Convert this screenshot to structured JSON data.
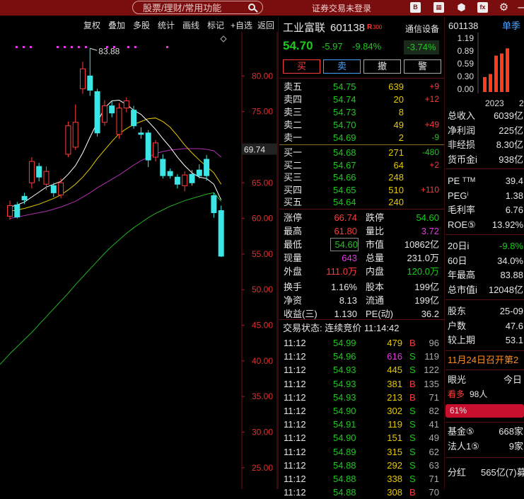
{
  "top": {
    "search_placeholder": "股票/理财/常用功能",
    "login_status": "证券交易未登录"
  },
  "toolbar": [
    "复权",
    "叠加",
    "多股",
    "统计",
    "画线",
    "标记",
    "+自选",
    "返回"
  ],
  "chart_data": {
    "type": "candlestick",
    "ylim": [
      22,
      85
    ],
    "y_ticks": [
      "80.00",
      "75.00",
      "70.00",
      "65.00",
      "60.00",
      "55.00",
      "50.00",
      "45.00",
      "40.00",
      "35.00",
      "30.00",
      "25.00"
    ],
    "y_tick_values": [
      80,
      75,
      70,
      65,
      60,
      55,
      50,
      45,
      40,
      35,
      30,
      25
    ],
    "current_price_label": "69.74",
    "current_price_value": 69.74,
    "high_annotation": "83.88",
    "candles": [
      {
        "o": 60.3,
        "c": 61.8,
        "h": 62.5,
        "l": 59.8
      },
      {
        "o": 61.9,
        "c": 60.2,
        "h": 62.3,
        "l": 60.0
      },
      {
        "o": 63.1,
        "c": 62.6,
        "h": 63.6,
        "l": 62.0
      },
      {
        "o": 65.0,
        "c": 68.0,
        "h": 68.6,
        "l": 64.2
      },
      {
        "o": 67.3,
        "c": 65.8,
        "h": 67.8,
        "l": 65.2
      },
      {
        "o": 64.8,
        "c": 66.6,
        "h": 67.3,
        "l": 64.0
      },
      {
        "o": 64.6,
        "c": 63.6,
        "h": 65.0,
        "l": 63.0
      },
      {
        "o": 63.3,
        "c": 65.0,
        "h": 65.6,
        "l": 62.8
      },
      {
        "o": 69.0,
        "c": 73.0,
        "h": 73.6,
        "l": 68.6
      },
      {
        "o": 70.0,
        "c": 73.5,
        "h": 76.0,
        "l": 69.6
      },
      {
        "o": 78.2,
        "c": 81.0,
        "h": 82.0,
        "l": 77.5
      },
      {
        "o": 80.0,
        "c": 78.0,
        "h": 83.88,
        "l": 77.2
      },
      {
        "o": 77.8,
        "c": 72.0,
        "h": 78.2,
        "l": 71.5
      },
      {
        "o": 73.5,
        "c": 75.8,
        "h": 76.6,
        "l": 73.0
      },
      {
        "o": 75.8,
        "c": 74.8,
        "h": 76.4,
        "l": 74.2
      },
      {
        "o": 71.8,
        "c": 75.5,
        "h": 76.2,
        "l": 71.2
      },
      {
        "o": 75.5,
        "c": 76.5,
        "h": 77.0,
        "l": 74.9
      },
      {
        "o": 75.2,
        "c": 73.0,
        "h": 75.8,
        "l": 72.6
      },
      {
        "o": 72.0,
        "c": 71.8,
        "h": 72.8,
        "l": 71.2
      },
      {
        "o": 72.0,
        "c": 68.2,
        "h": 72.4,
        "l": 67.2
      },
      {
        "o": 68.6,
        "c": 70.6,
        "h": 71.0,
        "l": 68.0
      },
      {
        "o": 68.3,
        "c": 66.0,
        "h": 69.0,
        "l": 65.6
      },
      {
        "o": 66.6,
        "c": 66.0,
        "h": 67.0,
        "l": 65.6
      },
      {
        "o": 65.8,
        "c": 64.8,
        "h": 66.2,
        "l": 64.2
      },
      {
        "o": 64.6,
        "c": 66.1,
        "h": 66.6,
        "l": 63.8
      },
      {
        "o": 66.2,
        "c": 65.0,
        "h": 66.8,
        "l": 64.6
      },
      {
        "o": 66.8,
        "c": 66.0,
        "h": 67.6,
        "l": 65.6
      },
      {
        "o": 68.3,
        "c": 66.0,
        "h": 68.9,
        "l": 65.3
      },
      {
        "o": 63.2,
        "c": 60.8,
        "h": 63.6,
        "l": 60.1
      },
      {
        "o": 61.1,
        "c": 54.7,
        "h": 61.8,
        "l": 54.6
      }
    ],
    "ma5": [
      61.6,
      61.9,
      62.3,
      63.0,
      63.7,
      64.4,
      64.8,
      65.2,
      66.2,
      67.4,
      69.2,
      71.4,
      73.5,
      75.5,
      76.5,
      76.6,
      76.0,
      75.2,
      74.6,
      73.6,
      72.5,
      71.2,
      70.0,
      68.6,
      67.4,
      66.4,
      65.8,
      65.6,
      64.8,
      62.6
    ],
    "ma10": [
      61.0,
      61.2,
      61.4,
      61.7,
      62.0,
      62.4,
      62.8,
      63.3,
      64.0,
      64.8,
      65.8,
      67.0,
      68.4,
      69.6,
      70.8,
      71.9,
      72.6,
      73.2,
      73.6,
      74.0,
      74.1,
      73.6,
      72.8,
      71.6,
      70.3,
      69.2,
      68.2,
      67.3,
      66.4,
      64.8
    ],
    "ma20": [
      60.0,
      60.2,
      60.4,
      60.6,
      60.8,
      61.0,
      61.3,
      61.6,
      62.0,
      62.4,
      63.0,
      63.6,
      64.3,
      64.9,
      65.5,
      66.1,
      66.8,
      67.5,
      68.1,
      68.6,
      69.1,
      69.4,
      69.6,
      69.7,
      69.8,
      69.8,
      69.8,
      69.7,
      69.5,
      68.6
    ],
    "ma60": [
      41.0,
      42.0,
      43.0,
      44.0,
      45.1,
      46.2,
      47.3,
      48.4,
      49.5,
      50.7,
      51.8,
      52.9,
      54.0,
      55.1,
      56.1,
      57.0,
      57.9,
      58.7,
      59.4,
      60.1,
      60.7,
      61.2,
      61.7,
      62.1,
      62.5,
      62.8,
      63.1,
      63.4,
      63.6,
      62.4
    ]
  },
  "quote": {
    "name": "工业富联",
    "code": "601138",
    "badge": "R",
    "badge_num": "300",
    "industry": "通信设备",
    "price": "54.70",
    "change": "-5.97",
    "pct": "-9.84%",
    "sector_pct": "-3.74%",
    "buttons": [
      "买",
      "卖",
      "撤",
      "警"
    ],
    "asks": [
      {
        "label": "卖五",
        "price": "54.75",
        "vol": "639",
        "chg": "+9"
      },
      {
        "label": "卖四",
        "price": "54.74",
        "vol": "20",
        "chg": "+12"
      },
      {
        "label": "卖三",
        "price": "54.73",
        "vol": "8",
        "chg": ""
      },
      {
        "label": "卖二",
        "price": "54.70",
        "vol": "49",
        "chg": "+49"
      },
      {
        "label": "卖一",
        "price": "54.69",
        "vol": "2",
        "chg": "-9"
      }
    ],
    "bids": [
      {
        "label": "买一",
        "price": "54.68",
        "vol": "271",
        "chg": "-480"
      },
      {
        "label": "买二",
        "price": "54.67",
        "vol": "64",
        "chg": "+2"
      },
      {
        "label": "买三",
        "price": "54.66",
        "vol": "248",
        "chg": ""
      },
      {
        "label": "买四",
        "price": "54.65",
        "vol": "510",
        "chg": "+110"
      },
      {
        "label": "买五",
        "price": "54.64",
        "vol": "240",
        "chg": ""
      }
    ],
    "stats": [
      [
        "涨停",
        "66.74",
        "跌停",
        "54.60"
      ],
      [
        "最高",
        "61.80",
        "量比",
        "3.72"
      ],
      [
        "最低",
        "54.60",
        "市值",
        "10862亿"
      ],
      [
        "现量",
        "643",
        "总量",
        "231.0万"
      ],
      [
        "外盘",
        "111.0万",
        "内盘",
        "120.0万"
      ],
      [
        "换手",
        "1.16%",
        "股本",
        "199亿"
      ],
      [
        "净资",
        "8.13",
        "流通",
        "199亿"
      ],
      [
        "收益(三)",
        "1.130",
        "PE(动)",
        "36.2"
      ]
    ],
    "trade_status": "交易状态: 连续竞价 11:14:42",
    "ticks": [
      [
        "11:12",
        "54.99",
        "479",
        "B",
        "96"
      ],
      [
        "11:12",
        "54.96",
        "616",
        "S",
        "119"
      ],
      [
        "11:12",
        "54.93",
        "445",
        "S",
        "122"
      ],
      [
        "11:12",
        "54.93",
        "381",
        "B",
        "135"
      ],
      [
        "11:12",
        "54.93",
        "213",
        "B",
        "71"
      ],
      [
        "11:12",
        "54.90",
        "302",
        "S",
        "82"
      ],
      [
        "11:12",
        "54.91",
        "119",
        "S",
        "41"
      ],
      [
        "11:12",
        "54.90",
        "151",
        "S",
        "49"
      ],
      [
        "11:12",
        "54.89",
        "315",
        "S",
        "62"
      ],
      [
        "11:12",
        "54.88",
        "292",
        "S",
        "63"
      ],
      [
        "11:12",
        "54.88",
        "338",
        "S",
        "71"
      ],
      [
        "11:12",
        "54.88",
        "308",
        "B",
        "70"
      ]
    ]
  },
  "far": {
    "code": "601138",
    "tab": "单季",
    "y_ticks": [
      "1.19",
      "0.89",
      "0.59",
      "0.30",
      "0.00"
    ],
    "bars": [
      0.35,
      0.42,
      0.85,
      0.9,
      1.02
    ],
    "year": "2023",
    "year2": "2",
    "fin": [
      [
        "总收入",
        "6039亿"
      ],
      [
        "净利润",
        "225亿"
      ],
      [
        "非经损",
        "8.30亿"
      ],
      [
        "货币金i",
        "938亿"
      ]
    ],
    "val": [
      [
        "PE ᵀᵀᴹ",
        "39.4"
      ],
      [
        "PEGⁱ",
        "1.38"
      ],
      [
        "毛利率",
        "6.76"
      ],
      [
        "ROE⑤",
        "13.92%"
      ]
    ],
    "perf": [
      [
        "20日i",
        "-9.8%"
      ],
      [
        "60日",
        "34.0%"
      ],
      [
        "年最高",
        "83.88"
      ],
      [
        "总市值i",
        "12048亿"
      ]
    ],
    "holders": [
      [
        "股东",
        "25-09"
      ],
      [
        "户数",
        "47.6"
      ],
      [
        "较上期",
        "53.1"
      ]
    ],
    "notice": "11月24日召开第2",
    "eye": "眼光",
    "today": "今日",
    "bull": "看多",
    "bull_count": "98人",
    "bull_pct": "61%",
    "inst": [
      [
        "基金⑤",
        "668家"
      ],
      [
        "法人1⑤",
        "9家"
      ]
    ],
    "div": "分红",
    "div_val": "565亿(7)募"
  }
}
